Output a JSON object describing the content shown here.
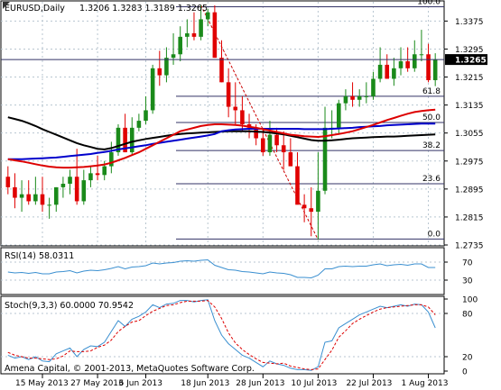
{
  "header": {
    "symbol": "EURUSD,Daily",
    "ohlc": "1.3206 1.3283 1.3189 1.3265"
  },
  "price_axis": {
    "ticks": [
      "1.3375",
      "1.3295",
      "1.3215",
      "1.3135",
      "1.3055",
      "1.2975",
      "1.2895",
      "1.2815",
      "1.2735"
    ],
    "current_label": "1.3265"
  },
  "date_axis": [
    "15 May 2013",
    "27 May 2013",
    "6 Jun 2013",
    "18 Jun 2013",
    "28 Jun 2013",
    "10 Jul 2013",
    "22 Jul 2013",
    "1 Aug 2013"
  ],
  "fibonacci": [
    "100.0",
    "61.8",
    "50.0",
    "38.2",
    "23.6",
    "0.0"
  ],
  "rsi_panel": {
    "label": "RSI(14) 58.0311",
    "ticks": [
      "70",
      "30"
    ]
  },
  "stoch_panel": {
    "label": "Stoch(9,3,3) 60.0000 70.9542",
    "ticks": [
      "100",
      "80",
      "20",
      "0"
    ]
  },
  "watermark": "Amena Capital, © 2001-2013, MetaQuotes Software Corp.",
  "colors": {
    "up": "#1a8a1a",
    "down": "#e00000",
    "ma_black": "#000000",
    "ma_blue": "#0000cc",
    "ma_red": "#dd0000",
    "grid": "#b8c6d0",
    "rsi": "#3a8fd0",
    "stoch_main": "#3a8fd0",
    "stoch_signal": "#dd0000"
  },
  "chart_data": {
    "type": "candlestick",
    "x": [
      "2013-05-08",
      "2013-05-09",
      "2013-05-10",
      "2013-05-13",
      "2013-05-14",
      "2013-05-15",
      "2013-05-16",
      "2013-05-17",
      "2013-05-20",
      "2013-05-21",
      "2013-05-22",
      "2013-05-23",
      "2013-05-24",
      "2013-05-27",
      "2013-05-28",
      "2013-05-29",
      "2013-05-30",
      "2013-05-31",
      "2013-06-03",
      "2013-06-04",
      "2013-06-05",
      "2013-06-06",
      "2013-06-07",
      "2013-06-10",
      "2013-06-11",
      "2013-06-12",
      "2013-06-13",
      "2013-06-14",
      "2013-06-17",
      "2013-06-18",
      "2013-06-19",
      "2013-06-20",
      "2013-06-21",
      "2013-06-24",
      "2013-06-25",
      "2013-06-26",
      "2013-06-27",
      "2013-06-28",
      "2013-07-01",
      "2013-07-02",
      "2013-07-03",
      "2013-07-04",
      "2013-07-05",
      "2013-07-08",
      "2013-07-09",
      "2013-07-10",
      "2013-07-11",
      "2013-07-12",
      "2013-07-15",
      "2013-07-16",
      "2013-07-17",
      "2013-07-18",
      "2013-07-19",
      "2013-07-22",
      "2013-07-23",
      "2013-07-24",
      "2013-07-25",
      "2013-07-26",
      "2013-07-29",
      "2013-07-30",
      "2013-07-31",
      "2013-08-01",
      "2013-08-02"
    ],
    "open": [
      1.293,
      1.29,
      1.287,
      1.288,
      1.286,
      1.288,
      1.285,
      1.285,
      1.29,
      1.291,
      1.293,
      1.286,
      1.292,
      1.294,
      1.2935,
      1.296,
      1.3,
      1.307,
      1.3,
      1.307,
      1.309,
      1.312,
      1.324,
      1.322,
      1.327,
      1.328,
      1.333,
      1.334,
      1.333,
      1.338,
      1.34,
      1.327,
      1.32,
      1.313,
      1.312,
      1.308,
      1.307,
      1.304,
      1.3,
      1.305,
      1.302,
      1.3,
      1.296,
      1.285,
      1.284,
      1.283,
      1.289,
      1.307,
      1.307,
      1.314,
      1.316,
      1.315,
      1.316,
      1.316,
      1.321,
      1.325,
      1.321,
      1.324,
      1.326,
      1.324,
      1.328,
      1.328,
      1.3206
    ],
    "high": [
      1.296,
      1.294,
      1.292,
      1.292,
      1.293,
      1.293,
      1.287,
      1.29,
      1.293,
      1.295,
      1.301,
      1.295,
      1.296,
      1.299,
      1.2975,
      1.303,
      1.308,
      1.311,
      1.31,
      1.311,
      1.316,
      1.325,
      1.329,
      1.33,
      1.334,
      1.336,
      1.338,
      1.34,
      1.342,
      1.341,
      1.342,
      1.332,
      1.324,
      1.32,
      1.316,
      1.311,
      1.308,
      1.307,
      1.309,
      1.307,
      1.306,
      1.304,
      1.3,
      1.288,
      1.29,
      1.3,
      1.313,
      1.312,
      1.315,
      1.318,
      1.32,
      1.318,
      1.32,
      1.323,
      1.33,
      1.328,
      1.327,
      1.33,
      1.33,
      1.332,
      1.335,
      1.331,
      1.3283
    ],
    "low": [
      1.288,
      1.284,
      1.283,
      1.285,
      1.285,
      1.283,
      1.281,
      1.283,
      1.287,
      1.288,
      1.285,
      1.285,
      1.29,
      1.292,
      1.292,
      1.294,
      1.299,
      1.3,
      1.299,
      1.306,
      1.308,
      1.311,
      1.319,
      1.32,
      1.325,
      1.326,
      1.33,
      1.332,
      1.332,
      1.336,
      1.327,
      1.32,
      1.31,
      1.308,
      1.306,
      1.304,
      1.302,
      1.299,
      1.299,
      1.3,
      1.295,
      1.296,
      1.286,
      1.28,
      1.276,
      1.275,
      1.288,
      1.304,
      1.305,
      1.312,
      1.313,
      1.313,
      1.314,
      1.315,
      1.32,
      1.321,
      1.319,
      1.322,
      1.323,
      1.323,
      1.326,
      1.32,
      1.3189
    ],
    "close": [
      1.29,
      1.287,
      1.288,
      1.286,
      1.288,
      1.285,
      1.285,
      1.29,
      1.291,
      1.293,
      1.286,
      1.292,
      1.294,
      1.2935,
      1.296,
      1.3,
      1.307,
      1.3,
      1.307,
      1.309,
      1.312,
      1.324,
      1.322,
      1.327,
      1.328,
      1.333,
      1.334,
      1.333,
      1.338,
      1.34,
      1.327,
      1.32,
      1.313,
      1.312,
      1.308,
      1.307,
      1.304,
      1.3,
      1.305,
      1.302,
      1.3,
      1.296,
      1.285,
      1.284,
      1.283,
      1.289,
      1.307,
      1.307,
      1.314,
      1.316,
      1.315,
      1.316,
      1.316,
      1.321,
      1.325,
      1.321,
      1.324,
      1.326,
      1.324,
      1.328,
      1.328,
      1.3206,
      1.3265
    ],
    "ma_black": [
      1.31,
      1.3095,
      1.309,
      1.3083,
      1.3075,
      1.3066,
      1.3058,
      1.305,
      1.3042,
      1.3034,
      1.3026,
      1.302,
      1.3015,
      1.301,
      1.3008,
      1.3012,
      1.3018,
      1.3024,
      1.303,
      1.3034,
      1.3038,
      1.3041,
      1.3044,
      1.3047,
      1.305,
      1.3052,
      1.3054,
      1.3055,
      1.3056,
      1.3057,
      1.3058,
      1.3059,
      1.306,
      1.306,
      1.306,
      1.306,
      1.3059,
      1.3058,
      1.3056,
      1.3054,
      1.3051,
      1.3047,
      1.3043,
      1.3039,
      1.3035,
      1.3033,
      1.3033,
      1.3034,
      1.3036,
      1.3038,
      1.304,
      1.3041,
      1.3042,
      1.3043,
      1.3044,
      1.3045,
      1.3045,
      1.3046,
      1.3047,
      1.3048,
      1.3049,
      1.305,
      1.3051
    ],
    "ma_blue": [
      1.298,
      1.298,
      1.298,
      1.2981,
      1.2982,
      1.2983,
      1.2984,
      1.2985,
      1.2987,
      1.2989,
      1.2991,
      1.2993,
      1.2995,
      1.2998,
      1.3001,
      1.3004,
      1.3008,
      1.3011,
      1.3014,
      1.3017,
      1.302,
      1.3024,
      1.3027,
      1.303,
      1.3033,
      1.3036,
      1.3039,
      1.3042,
      1.3045,
      1.3048,
      1.3052,
      1.306,
      1.3063,
      1.3065,
      1.3066,
      1.3067,
      1.3067,
      1.3067,
      1.3067,
      1.3067,
      1.3067,
      1.3067,
      1.3067,
      1.3066,
      1.3066,
      1.3066,
      1.3066,
      1.3067,
      1.3068,
      1.3069,
      1.307,
      1.3072,
      1.3073,
      1.3074,
      1.3075,
      1.3077,
      1.3078,
      1.3079,
      1.308,
      1.3081,
      1.3082,
      1.3082,
      1.3082
    ],
    "ma_red": [
      1.298,
      1.2977,
      1.2974,
      1.297,
      1.2966,
      1.2962,
      1.2959,
      1.2957,
      1.2956,
      1.2956,
      1.2957,
      1.2958,
      1.296,
      1.2962,
      1.2965,
      1.297,
      1.2977,
      1.2984,
      1.2992,
      1.3,
      1.301,
      1.302,
      1.303,
      1.304,
      1.305,
      1.306,
      1.3065,
      1.307,
      1.3075,
      1.3078,
      1.308,
      1.308,
      1.3079,
      1.3078,
      1.3076,
      1.3073,
      1.307,
      1.3066,
      1.3062,
      1.3058,
      1.3054,
      1.305,
      1.3048,
      1.3046,
      1.3045,
      1.3044,
      1.3046,
      1.3049,
      1.3052,
      1.3056,
      1.306,
      1.3066,
      1.3072,
      1.3078,
      1.3085,
      1.3092,
      1.3098,
      1.3104,
      1.311,
      1.3115,
      1.3118,
      1.312,
      1.3122
    ],
    "fib_levels": [
      {
        "label": "100.0",
        "price": 1.3416
      },
      {
        "label": "61.8",
        "price": 1.316
      },
      {
        "label": "50.0",
        "price": 1.3085
      },
      {
        "label": "38.2",
        "price": 1.3005
      },
      {
        "label": "23.6",
        "price": 1.291
      },
      {
        "label": "0.0",
        "price": 1.2752
      }
    ],
    "rsi": [
      48,
      46,
      47,
      45,
      47,
      44,
      44,
      48,
      49,
      51,
      46,
      50,
      52,
      51,
      53,
      56,
      60,
      55,
      59,
      60,
      62,
      68,
      66,
      68,
      69,
      72,
      73,
      72,
      74,
      75,
      63,
      58,
      53,
      52,
      49,
      48,
      46,
      44,
      48,
      46,
      45,
      42,
      36,
      36,
      35,
      41,
      55,
      55,
      60,
      61,
      60,
      61,
      61,
      64,
      66,
      62,
      64,
      65,
      63,
      66,
      66,
      58,
      58
    ],
    "stoch_main": [
      22,
      18,
      20,
      16,
      20,
      14,
      13,
      24,
      28,
      32,
      20,
      30,
      35,
      34,
      40,
      55,
      70,
      62,
      72,
      76,
      82,
      92,
      88,
      93,
      94,
      98,
      98,
      96,
      98,
      99,
      70,
      50,
      38,
      30,
      22,
      18,
      12,
      6,
      14,
      10,
      8,
      4,
      2,
      2,
      1,
      6,
      40,
      42,
      60,
      66,
      72,
      78,
      82,
      86,
      90,
      88,
      90,
      92,
      90,
      93,
      92,
      82,
      60
    ],
    "stoch_signal": [
      26,
      22,
      20,
      18,
      18,
      17,
      16,
      17,
      21,
      28,
      27,
      27,
      28,
      33,
      36,
      43,
      55,
      62,
      68,
      70,
      77,
      83,
      87,
      91,
      92,
      95,
      97,
      97,
      97,
      98,
      89,
      73,
      53,
      39,
      30,
      23,
      17,
      12,
      11,
      10,
      11,
      7,
      5,
      3,
      2,
      3,
      16,
      29,
      47,
      56,
      66,
      72,
      77,
      82,
      86,
      88,
      89,
      90,
      91,
      92,
      92,
      89,
      78
    ],
    "rsi_range": [
      0,
      100
    ],
    "stoch_range": [
      0,
      100
    ],
    "price_range": [
      1.2735,
      1.343
    ]
  }
}
